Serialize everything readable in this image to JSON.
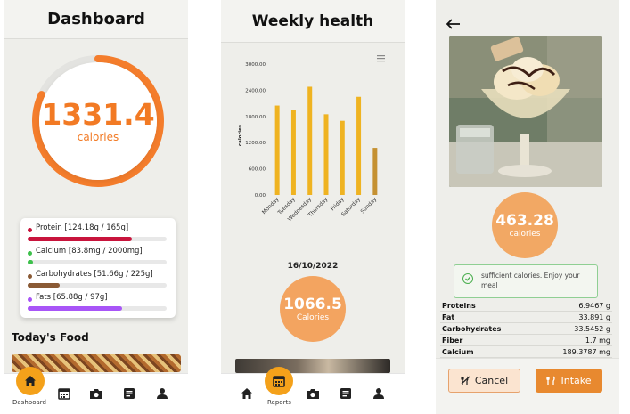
{
  "dashboard": {
    "title": "Dashboard",
    "calories_value": "1331.4",
    "calories_unit": "calories",
    "calorie_progress": 0.82,
    "nutrients": [
      {
        "label": "Protein [124.18g / 165g]",
        "color": "#c8143c",
        "fraction": 0.75
      },
      {
        "label": "Calcium [83.8mg / 2000mg]",
        "color": "#3dc04b",
        "fraction": 0.04
      },
      {
        "label": "Carbohydrates [51.66g / 225g]",
        "color": "#8a5a35",
        "fraction": 0.23
      },
      {
        "label": "Fats [65.88g / 97g]",
        "color": "#a855f7",
        "fraction": 0.68
      }
    ],
    "section_title": "Today's Food",
    "nav_label": "Dashboard",
    "accent": "#f27a24"
  },
  "weekly": {
    "title": "Weekly health",
    "menu_icon": "hamburger-icon",
    "date": "16/10/2022",
    "calories_value": "1066.5",
    "calories_unit": "Calories",
    "nav_label": "Reports"
  },
  "chart_data": {
    "type": "bar",
    "categories": [
      "Monday",
      "Tuesday",
      "Wednesday",
      "Thursday",
      "Friday",
      "Saturday",
      "Sunday"
    ],
    "values": [
      2050,
      1950,
      2480,
      1850,
      1700,
      2250,
      1080
    ],
    "ylabel": "calories",
    "ylim": [
      0,
      3000
    ],
    "yticks": [
      "0.00",
      "600.00",
      "1200.00",
      "1800.00",
      "2400.00",
      "3000.00"
    ],
    "bar_color": "#efb321",
    "last_bar_color": "#c59132",
    "grid": false
  },
  "detail": {
    "back_icon": "arrow-left-icon",
    "calories_value": "463.28",
    "calories_unit": "calories",
    "alert_text": "sufficient calories. Enjoy your meal",
    "nutrients": [
      {
        "name": "Proteins",
        "value": "6.9467 g"
      },
      {
        "name": "Fat",
        "value": "33.891 g"
      },
      {
        "name": "Carbohydrates",
        "value": "33.5452 g"
      },
      {
        "name": "Fiber",
        "value": "1.7 mg"
      },
      {
        "name": "Calcium",
        "value": "189.3787 mg"
      }
    ],
    "cancel_label": "Cancel",
    "intake_label": "Intake"
  }
}
